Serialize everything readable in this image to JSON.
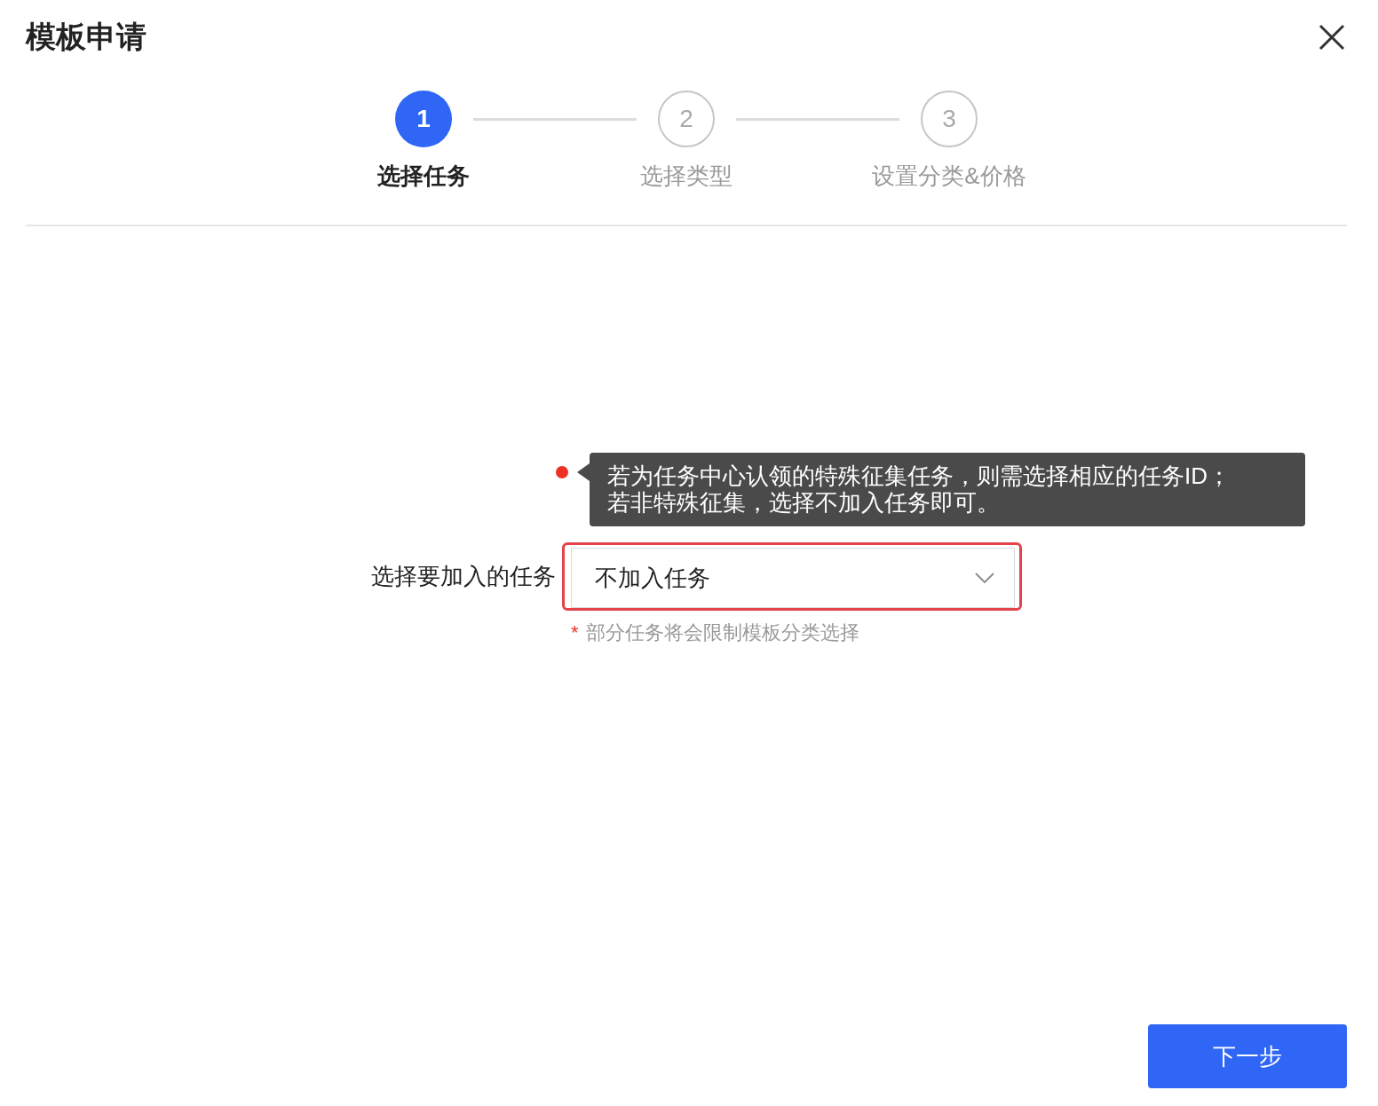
{
  "dialog": {
    "title": "模板申请"
  },
  "steps": [
    {
      "number": "1",
      "label": "选择任务",
      "selected": true
    },
    {
      "number": "2",
      "label": "选择类型",
      "selected": false
    },
    {
      "number": "3",
      "label": "设置分类&价格",
      "selected": false
    }
  ],
  "form": {
    "tooltip": "若为任务中心认领的特殊征集任务，则需选择相应的任务ID；若非特殊征集，选择不加入任务即可。",
    "label": "选择要加入的任务",
    "select": {
      "value": "不加入任务",
      "highlighted": true
    },
    "hint_mark": "*",
    "hint": "部分任务将会限制模板分类选择"
  },
  "footer": {
    "next_button": "下一步"
  }
}
